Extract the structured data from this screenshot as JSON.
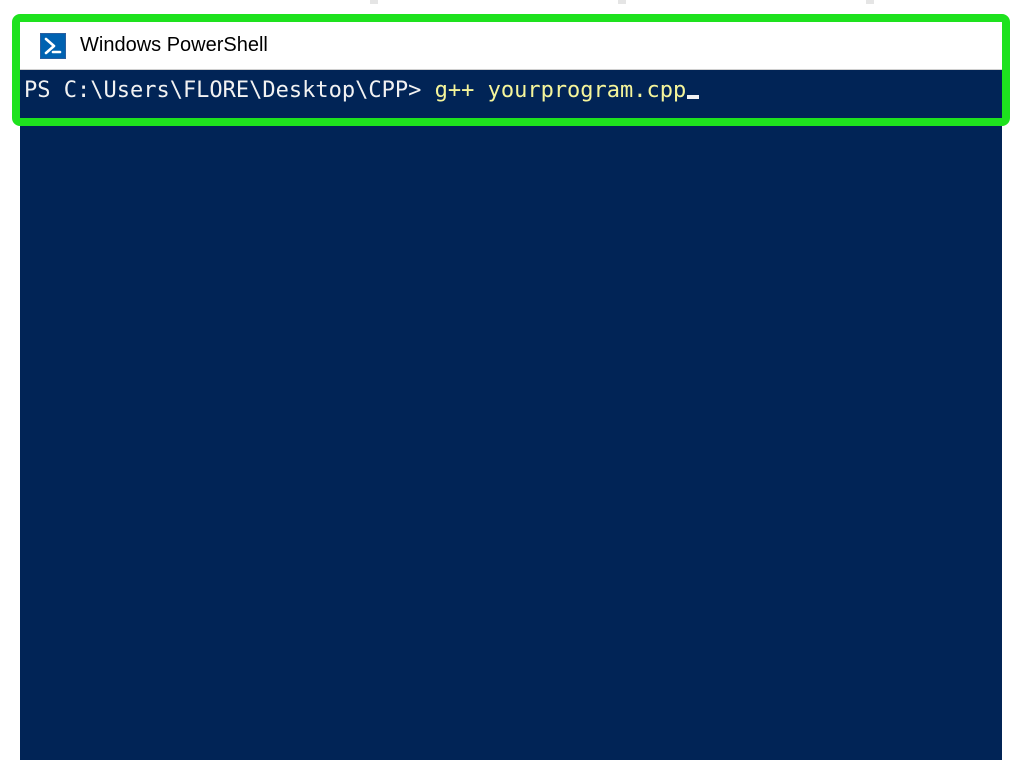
{
  "window": {
    "title": "Windows PowerShell"
  },
  "terminal": {
    "prompt": "PS C:\\Users\\FLORE\\Desktop\\CPP> ",
    "command": "g++ yourprogram.cpp"
  },
  "colors": {
    "highlight_border": "#1ee21e",
    "terminal_bg": "#012456",
    "prompt_text": "#f2f2f2",
    "command_text": "#f5f59b",
    "ps_icon_bg": "#0062b1"
  }
}
